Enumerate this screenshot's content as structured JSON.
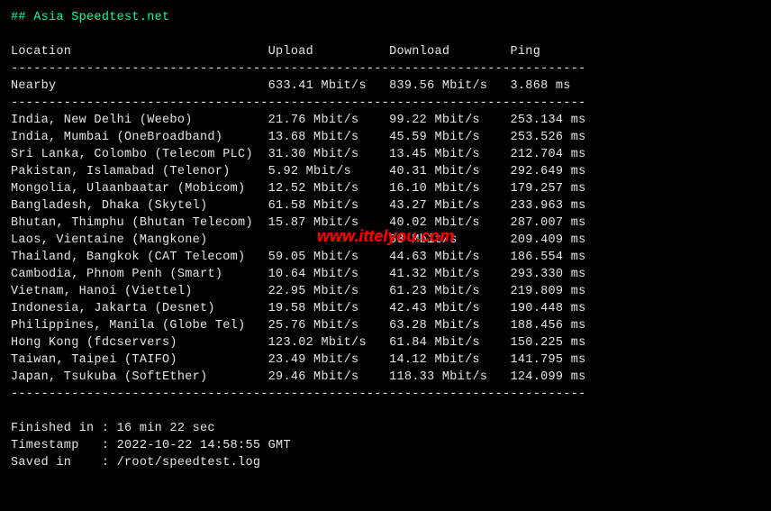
{
  "title": "## Asia Speedtest.net",
  "header": {
    "location": "Location",
    "upload": "Upload",
    "download": "Download",
    "ping": "Ping"
  },
  "nearby": {
    "label": "Nearby",
    "upload": "633.41 Mbit/s",
    "download": "839.56 Mbit/s",
    "ping": "3.868 ms"
  },
  "rows": [
    {
      "loc": "India, New Delhi (Weebo)",
      "up": "21.76 Mbit/s",
      "down": "99.22 Mbit/s",
      "ping": "253.134 ms"
    },
    {
      "loc": "India, Mumbai (OneBroadband)",
      "up": "13.68 Mbit/s",
      "down": "45.59 Mbit/s",
      "ping": "253.526 ms"
    },
    {
      "loc": "Sri Lanka, Colombo (Telecom PLC)",
      "up": "31.30 Mbit/s",
      "down": "13.45 Mbit/s",
      "ping": "212.704 ms"
    },
    {
      "loc": "Pakistan, Islamabad (Telenor)",
      "up": "5.92 Mbit/s",
      "down": "40.31 Mbit/s",
      "ping": "292.649 ms"
    },
    {
      "loc": "Mongolia, Ulaanbaatar (Mobicom)",
      "up": "12.52 Mbit/s",
      "down": "16.10 Mbit/s",
      "ping": "179.257 ms"
    },
    {
      "loc": "Bangladesh, Dhaka (Skytel)",
      "up": "61.58 Mbit/s",
      "down": "43.27 Mbit/s",
      "ping": "233.963 ms"
    },
    {
      "loc": "Bhutan, Thimphu (Bhutan Telecom)",
      "up": "15.87 Mbit/s",
      "down": "40.02 Mbit/s",
      "ping": "287.007 ms"
    },
    {
      "loc": "Laos, Vientaine (Mangkone)",
      "up": "",
      "down": "53 Mbit/s",
      "ping": "209.409 ms"
    },
    {
      "loc": "Thailand, Bangkok (CAT Telecom)",
      "up": "59.05 Mbit/s",
      "down": "44.63 Mbit/s",
      "ping": "186.554 ms"
    },
    {
      "loc": "Cambodia, Phnom Penh (Smart)",
      "up": "10.64 Mbit/s",
      "down": "41.32 Mbit/s",
      "ping": "293.330 ms"
    },
    {
      "loc": "Vietnam, Hanoi (Viettel)",
      "up": "22.95 Mbit/s",
      "down": "61.23 Mbit/s",
      "ping": "219.809 ms"
    },
    {
      "loc": "Indonesia, Jakarta (Desnet)",
      "up": "19.58 Mbit/s",
      "down": "42.43 Mbit/s",
      "ping": "190.448 ms"
    },
    {
      "loc": "Philippines, Manila (Globe Tel)",
      "up": "25.76 Mbit/s",
      "down": "63.28 Mbit/s",
      "ping": "188.456 ms"
    },
    {
      "loc": "Hong Kong (fdcservers)",
      "up": "123.02 Mbit/s",
      "down": "61.84 Mbit/s",
      "ping": "150.225 ms"
    },
    {
      "loc": "Taiwan, Taipei (TAIFO)",
      "up": "23.49 Mbit/s",
      "down": "14.12 Mbit/s",
      "ping": "141.795 ms"
    },
    {
      "loc": "Japan, Tsukuba (SoftEther)",
      "up": "29.46 Mbit/s",
      "down": "118.33 Mbit/s",
      "ping": "124.099 ms"
    }
  ],
  "footer": {
    "finished_label": "Finished in",
    "finished_val": "16 min 22 sec",
    "timestamp_label": "Timestamp",
    "timestamp_val": "2022-10-22 14:58:55 GMT",
    "saved_label": "Saved in",
    "saved_val": "/root/speedtest.log"
  },
  "watermark": "www.ittelyou.com",
  "chart_data": {
    "type": "table",
    "title": "Asia Speedtest.net",
    "columns": [
      "Location",
      "Upload (Mbit/s)",
      "Download (Mbit/s)",
      "Ping (ms)"
    ],
    "rows": [
      [
        "Nearby",
        633.41,
        839.56,
        3.868
      ],
      [
        "India, New Delhi (Weebo)",
        21.76,
        99.22,
        253.134
      ],
      [
        "India, Mumbai (OneBroadband)",
        13.68,
        45.59,
        253.526
      ],
      [
        "Sri Lanka, Colombo (Telecom PLC)",
        31.3,
        13.45,
        212.704
      ],
      [
        "Pakistan, Islamabad (Telenor)",
        5.92,
        40.31,
        292.649
      ],
      [
        "Mongolia, Ulaanbaatar (Mobicom)",
        12.52,
        16.1,
        179.257
      ],
      [
        "Bangladesh, Dhaka (Skytel)",
        61.58,
        43.27,
        233.963
      ],
      [
        "Bhutan, Thimphu (Bhutan Telecom)",
        15.87,
        40.02,
        287.007
      ],
      [
        "Laos, Vientaine (Mangkone)",
        null,
        53,
        209.409
      ],
      [
        "Thailand, Bangkok (CAT Telecom)",
        59.05,
        44.63,
        186.554
      ],
      [
        "Cambodia, Phnom Penh (Smart)",
        10.64,
        41.32,
        293.33
      ],
      [
        "Vietnam, Hanoi (Viettel)",
        22.95,
        61.23,
        219.809
      ],
      [
        "Indonesia, Jakarta (Desnet)",
        19.58,
        42.43,
        190.448
      ],
      [
        "Philippines, Manila (Globe Tel)",
        25.76,
        63.28,
        188.456
      ],
      [
        "Hong Kong (fdcservers)",
        123.02,
        61.84,
        150.225
      ],
      [
        "Taiwan, Taipei (TAIFO)",
        23.49,
        14.12,
        141.795
      ],
      [
        "Japan, Tsukuba (SoftEther)",
        29.46,
        118.33,
        124.099
      ]
    ]
  }
}
